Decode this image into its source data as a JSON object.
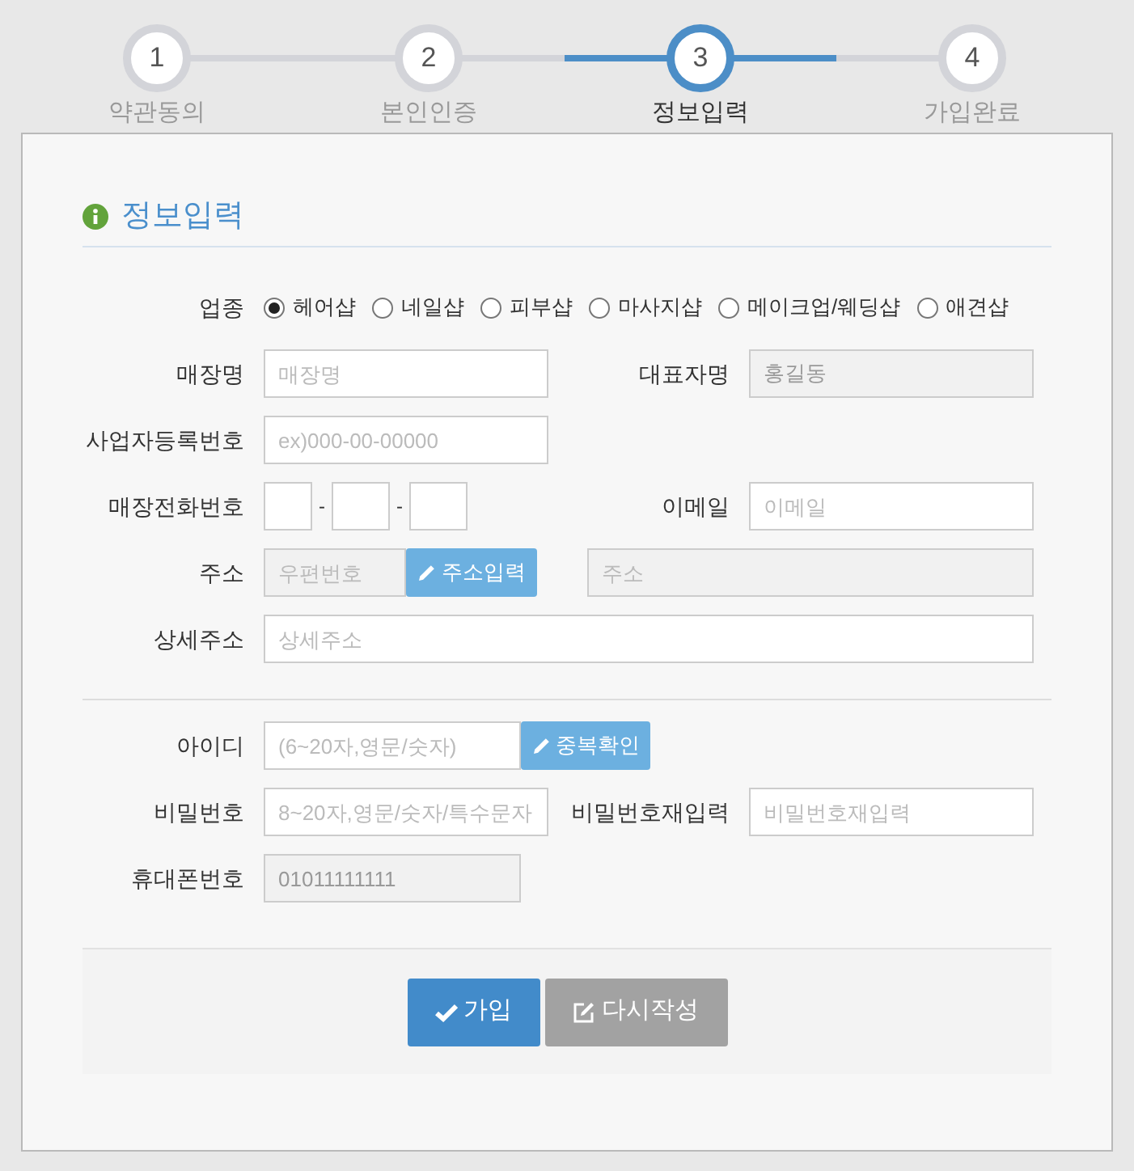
{
  "steps": [
    {
      "number": "1",
      "label": "약관동의",
      "selected": false
    },
    {
      "number": "2",
      "label": "본인인증",
      "selected": false
    },
    {
      "number": "3",
      "label": "정보입력",
      "selected": true
    },
    {
      "number": "4",
      "label": "가입완료",
      "selected": false
    }
  ],
  "section_title": "정보입력",
  "business_type": {
    "label": "업종",
    "options": [
      {
        "label": "헤어샵",
        "selected": true
      },
      {
        "label": "네일샵",
        "selected": false
      },
      {
        "label": "피부샵",
        "selected": false
      },
      {
        "label": "마사지샵",
        "selected": false
      },
      {
        "label": "메이크업/웨딩샵",
        "selected": false
      },
      {
        "label": "애견샵",
        "selected": false
      }
    ]
  },
  "sections": [
    {
      "rows": [
        {
          "kind": "pair",
          "label": "매장명",
          "field": {
            "placeholder": "매장명",
            "disabled": false
          },
          "right_label": "대표자명",
          "right_field": {
            "value": "홍길동",
            "disabled": true
          }
        },
        {
          "kind": "single",
          "label": "사업자등록번호",
          "field": {
            "placeholder": "ex)000-00-00000",
            "disabled": false
          }
        },
        {
          "kind": "phone",
          "label": "매장전화번호",
          "separators": [
            "-",
            "-"
          ],
          "right_label": "이메일",
          "right_field": {
            "placeholder": "이메일",
            "disabled": false
          }
        },
        {
          "kind": "address",
          "label": "주소",
          "field": {
            "placeholder": "우편번호",
            "disabled": true
          },
          "button": "주소입력",
          "right_field": {
            "placeholder": "주소",
            "disabled": true
          }
        },
        {
          "kind": "wide",
          "label": "상세주소",
          "field": {
            "placeholder": "상세주소",
            "disabled": false
          }
        }
      ]
    },
    {
      "rows": [
        {
          "kind": "id",
          "label": "아이디",
          "field": {
            "placeholder": "(6~20자,영문/숫자)",
            "disabled": false
          },
          "button": "중복확인"
        },
        {
          "kind": "pair",
          "label": "비밀번호",
          "field": {
            "placeholder": "8~20자,영문/숫자/특수문자",
            "disabled": false
          },
          "right_label": "비밀번호재입력",
          "right_field": {
            "placeholder": "비밀번호재입력",
            "disabled": false
          }
        },
        {
          "kind": "single",
          "label": "휴대폰번호",
          "field": {
            "value": "01011111111",
            "disabled": true
          }
        }
      ]
    }
  ],
  "buttons": [
    {
      "label": "가입",
      "kind": "primary"
    },
    {
      "label": "다시작성",
      "kind": "secondary"
    }
  ]
}
